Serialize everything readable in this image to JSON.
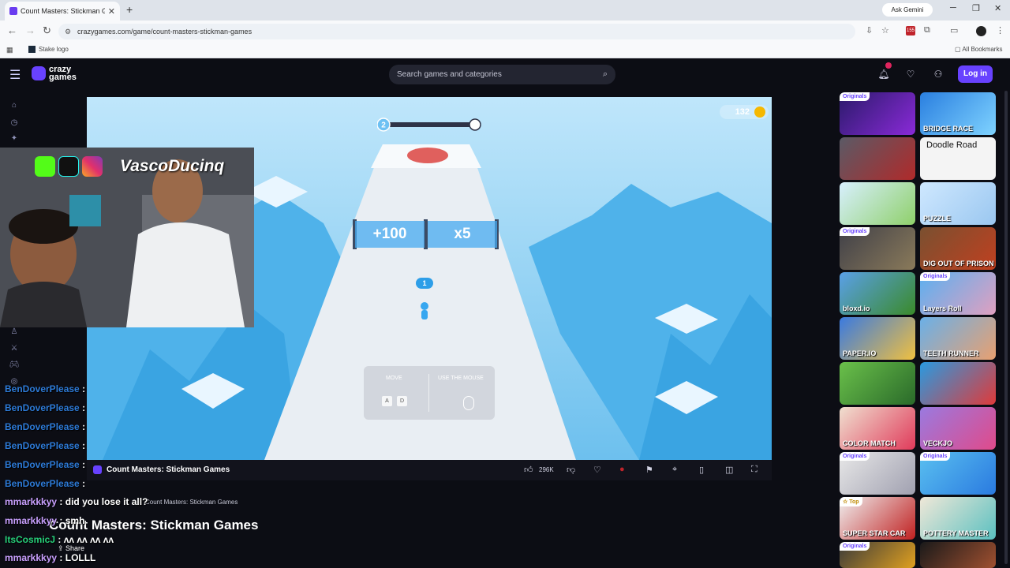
{
  "browser": {
    "tab_title": "Count Masters: Stickman Ga",
    "url": "crazygames.com/game/count-masters-stickman-games",
    "ask_gemini": "Ask Gemini",
    "bookmark_stake": "Stake logo",
    "all_bookmarks": "All Bookmarks",
    "extension_badge": "155"
  },
  "site": {
    "logo_line1": "crazy",
    "logo_line2": "games",
    "search_placeholder": "Search games and categories",
    "login_label": "Log in"
  },
  "game": {
    "coins": "132",
    "level": "2",
    "gate_left": "+100",
    "gate_right": "x5",
    "crowd_count": "1",
    "control_move": "MOVE",
    "control_mouse": "USE THE MOUSE",
    "key_a": "A",
    "key_d": "D"
  },
  "gamebar": {
    "title": "Count Masters: Stickman Games",
    "likes": "296K"
  },
  "page": {
    "breadcrumb_current": "Count Masters: Stickman Games",
    "title": "Count Masters: Stickman Games",
    "share_label": "Share"
  },
  "stream": {
    "handle": "VascoDucinq",
    "chat": [
      {
        "user": "BenDoverPlease",
        "msg": ":"
      },
      {
        "user": "BenDoverPlease",
        "msg": ":"
      },
      {
        "user": "BenDoverPlease",
        "msg": ":"
      },
      {
        "user": "BenDoverPlease",
        "msg": ":"
      },
      {
        "user": "BenDoverPlease",
        "msg": ":"
      },
      {
        "user": "BenDoverPlease",
        "msg": ":"
      },
      {
        "user": "mmarkkkyy",
        "msg": ": did you lose it all?"
      },
      {
        "user": "mmarkkkyy",
        "msg": ": smh"
      },
      {
        "user": "ItsCosmicJ",
        "msg": ": ʌʌ ʌʌ ʌʌ ʌʌ"
      },
      {
        "user": "mmarkkkyy",
        "msg": ": LOLLL"
      }
    ]
  },
  "rail": {
    "originals_label": "Originals",
    "top_label": "Top",
    "games": [
      "",
      "BRIDGE RACE",
      "",
      "Doodle Road",
      "",
      "PUZZLE",
      "",
      "DIG OUT OF PRISON",
      "bloxd.io",
      "Layers Roll",
      "PAPER.IO",
      "TEETH RUNNER",
      "",
      "",
      "COLOR MATCH",
      "VECKJO",
      "",
      "",
      "SUPER STAR CAR",
      "POTTERY MASTER",
      "",
      ""
    ]
  }
}
